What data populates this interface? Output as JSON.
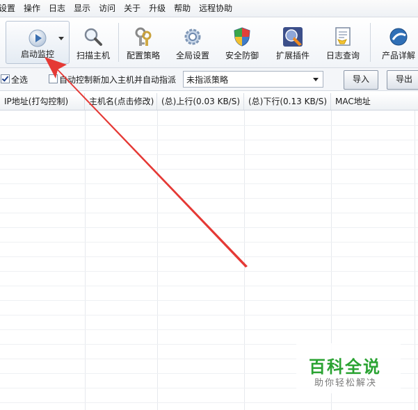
{
  "menu": [
    "设置",
    "操作",
    "日志",
    "显示",
    "访问",
    "关于",
    "升级",
    "帮助",
    "远程协助"
  ],
  "toolbar": {
    "start": "启动监控",
    "scan": "扫描主机",
    "policy": "配置策略",
    "global": "全局设置",
    "security": "安全防御",
    "plugins": "扩展插件",
    "logs": "日志查询",
    "product": "产品详解"
  },
  "options": {
    "select_all": "全选",
    "auto_control": "自动控制新加入主机并自动指派",
    "policy_value": "未指派策略",
    "import": "导入",
    "export": "导出"
  },
  "columns": [
    "IP地址(打勾控制)",
    "主机名(点击修改)",
    "(总)上行(0.03 KB/S)",
    "(总)下行(0.13 KB/S)",
    "MAC地址"
  ],
  "watermark": {
    "title": "百科全说",
    "subtitle": "助你轻松解决"
  },
  "colors": {
    "accent_arrow": "#e53935",
    "watermark_green": "#2aa332"
  }
}
